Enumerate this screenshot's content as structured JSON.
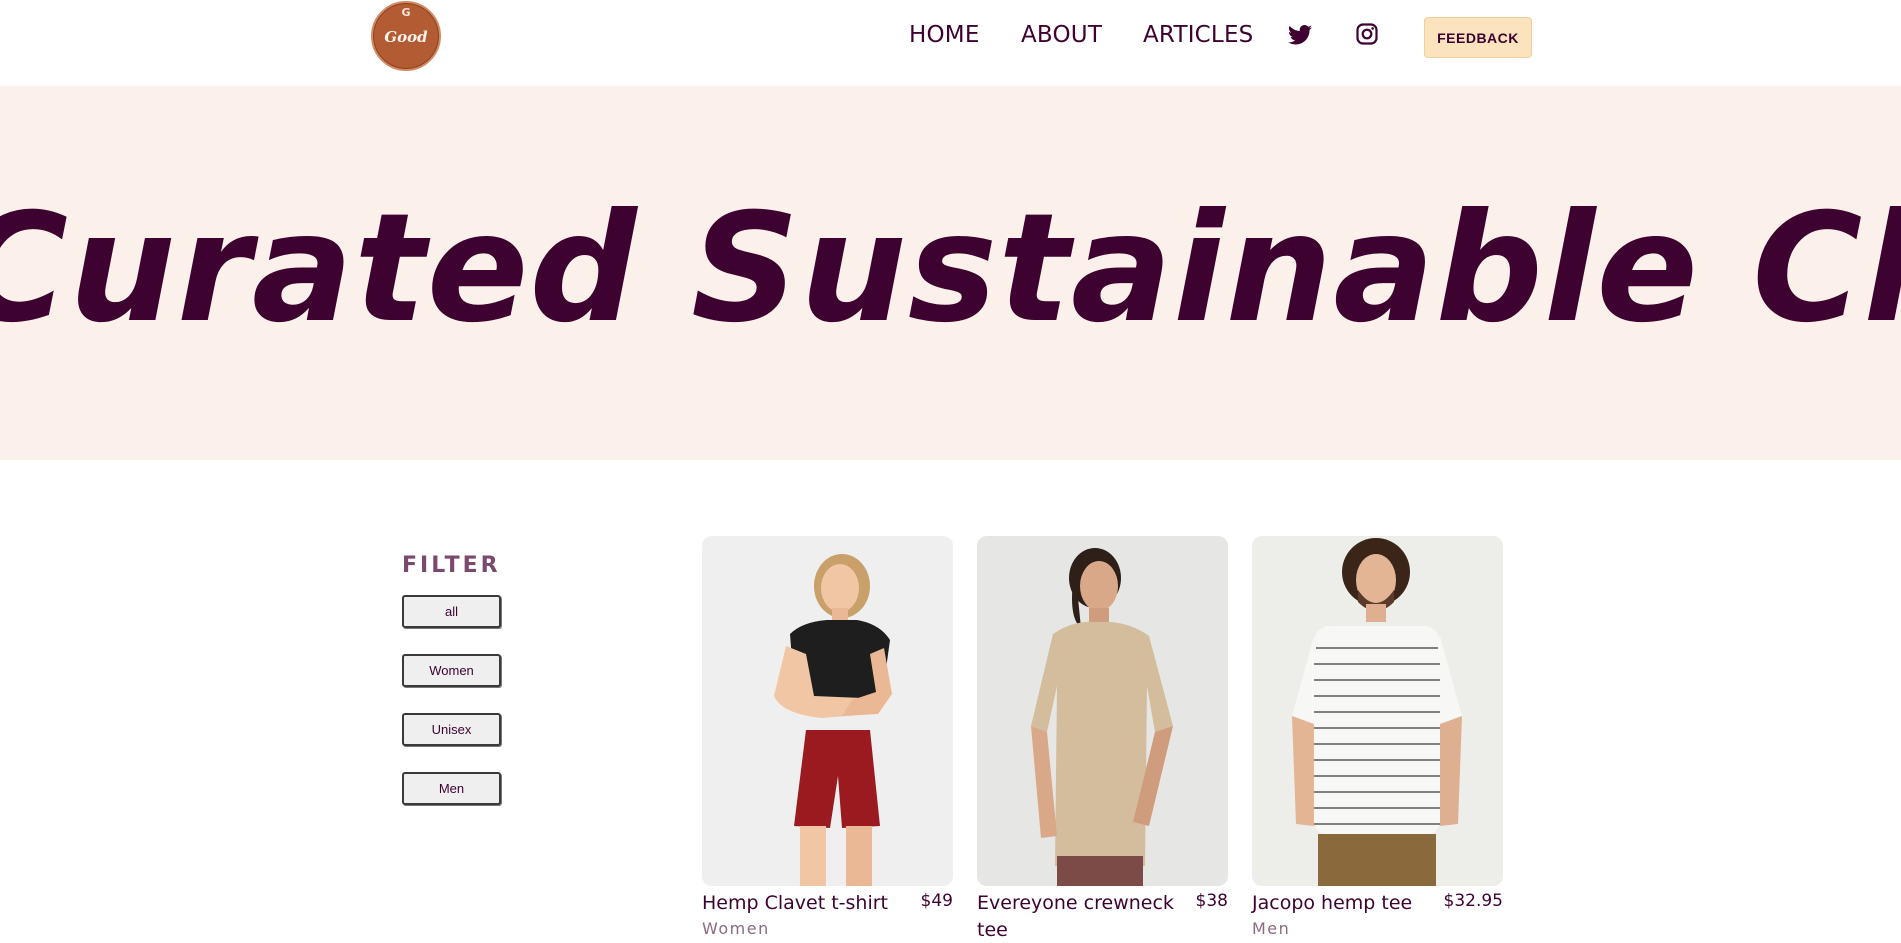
{
  "logo": {
    "top_letter": "G",
    "text": "Good"
  },
  "nav": {
    "home": "HOME",
    "about": "ABOUT",
    "articles": "ARTICLES"
  },
  "social": {
    "twitter": "twitter-icon",
    "instagram": "instagram-icon"
  },
  "feedback": {
    "label": "FEEDBACK"
  },
  "banner": {
    "text": "Curated Sustainable Cloth's"
  },
  "filter": {
    "title": "FILTER",
    "options": [
      "all",
      "Women",
      "Unisex",
      "Men"
    ]
  },
  "products": [
    {
      "name": "Hemp Clavet t-shirt",
      "price": "$49",
      "category": "Women"
    },
    {
      "name": "Evereyone crewneck tee",
      "price": "$38",
      "category": ""
    },
    {
      "name": "Jacopo hemp tee",
      "price": "$32.95",
      "category": "Men"
    }
  ],
  "colors": {
    "brand": "#3d0230",
    "banner_bg": "#fcf0eb",
    "feedback_bg": "#fbe3bd",
    "logo_bg": "#b35c34"
  }
}
